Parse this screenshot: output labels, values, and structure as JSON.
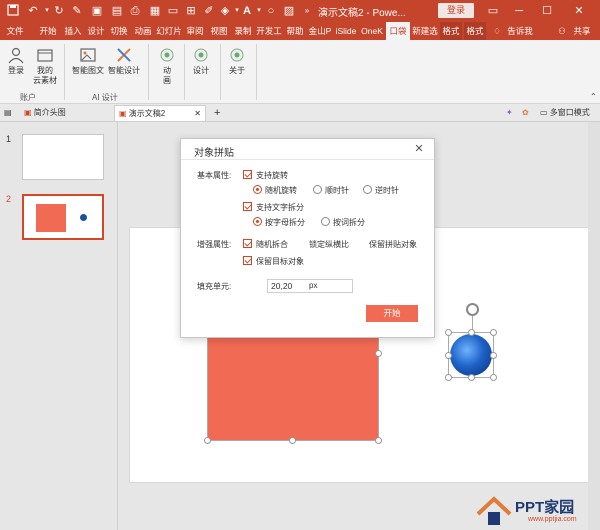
{
  "titlebar": {
    "title": "演示文稿2  -  Powe...",
    "login": "登录"
  },
  "tabs": [
    {
      "label": "文件"
    },
    {
      "label": "开始"
    },
    {
      "label": "插入"
    },
    {
      "label": "设计"
    },
    {
      "label": "切换"
    },
    {
      "label": "动画"
    },
    {
      "label": "幻灯片"
    },
    {
      "label": "审阅"
    },
    {
      "label": "视图"
    },
    {
      "label": "录制"
    },
    {
      "label": "开发工"
    },
    {
      "label": "帮助"
    },
    {
      "label": "金山P"
    },
    {
      "label": "iSlide"
    },
    {
      "label": "OneK"
    },
    {
      "label": "口袋"
    },
    {
      "label": "新建选"
    },
    {
      "label": "格式"
    },
    {
      "label": "格式"
    }
  ],
  "tell_me": "告诉我",
  "share": "共享",
  "ribbon": {
    "login": "登录",
    "my_cloud_line1": "我的",
    "my_cloud_line2": "云素材",
    "group_account": "账户",
    "smart_pic": "智能图文",
    "smart_design": "智能设计",
    "group_ai": "AI 设计",
    "anim_line1": "动",
    "anim_line2": "画",
    "design": "设计",
    "about": "关于"
  },
  "doctabs": {
    "tab1": "简介头图",
    "tab2": "演示文稿2",
    "plus": "+",
    "multi_window": "多窗口模式"
  },
  "slides": [
    {
      "num": "1"
    },
    {
      "num": "2"
    }
  ],
  "dialog": {
    "title": "对象拼贴",
    "basic_label": "基本属性:",
    "support_rotate": "支持旋转",
    "random_rotate": "随机旋转",
    "clockwise": "顺时针",
    "counter_clockwise": "逆时针",
    "support_text_split": "支持文字拆分",
    "split_by_letter": "按字母拆分",
    "split_by_word": "按词拆分",
    "enhance_label": "增强属性:",
    "random_split": "随机拆合",
    "lock_ratio": "锁定纵横比",
    "keep_collage": "保留拼贴对象",
    "keep_target": "保留目标对象",
    "fill_label": "填充单元:",
    "fill_value": "20,20",
    "unit": "px",
    "start": "开始"
  },
  "watermark": {
    "text": "PPT家园",
    "url": "www.pptjia.com"
  },
  "colors": {
    "accent": "#c4442c",
    "shape": "#f16a54"
  }
}
